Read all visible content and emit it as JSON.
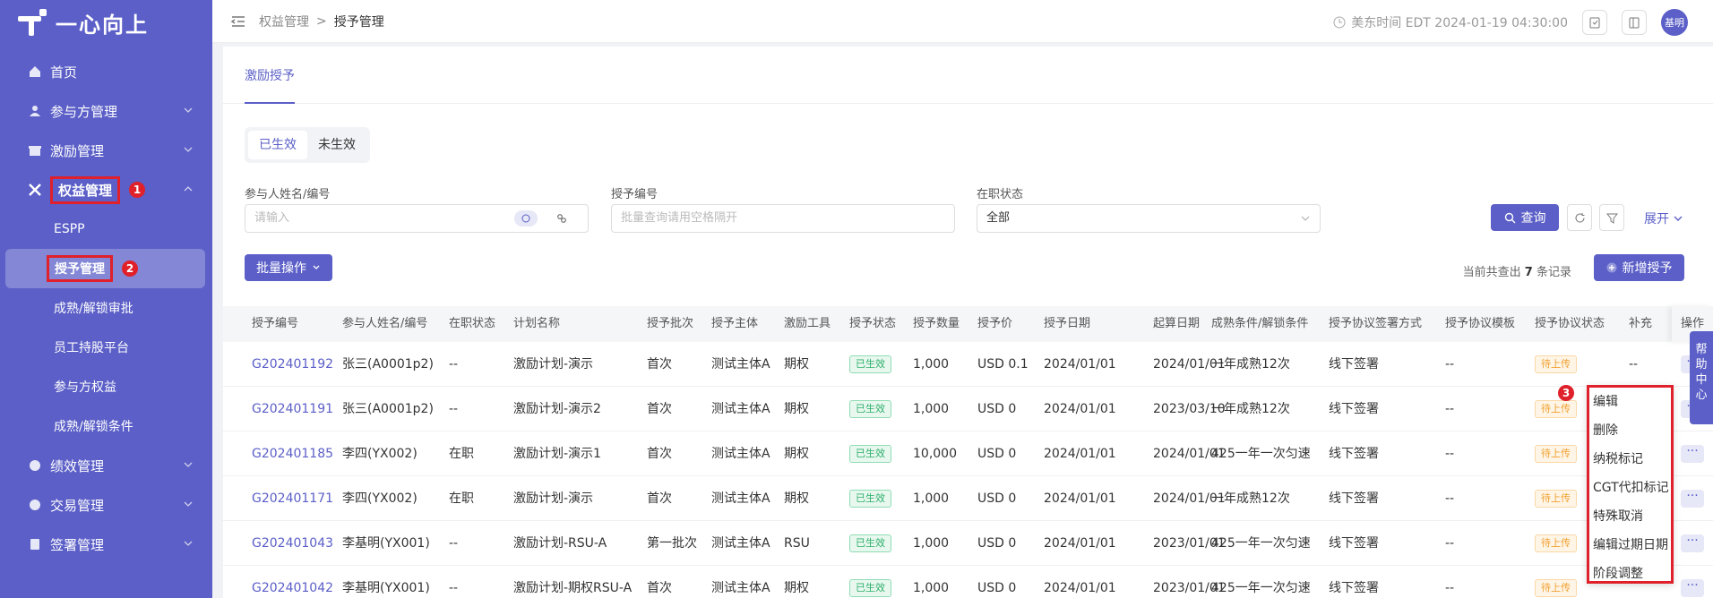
{
  "sidebar": {
    "logo_text": "一心向上",
    "items": [
      {
        "label": "首页",
        "icon": "home-icon"
      },
      {
        "label": "参与方管理",
        "icon": "users-icon"
      },
      {
        "label": "激励管理",
        "icon": "gift-icon"
      },
      {
        "label": "权益管理",
        "icon": "equity-icon"
      }
    ],
    "sub_items": [
      "ESPP",
      "授予管理",
      "成熟/解锁审批",
      "员工持股平台",
      "参与方权益",
      "成熟/解锁条件"
    ],
    "bottom_items": [
      {
        "label": "绩效管理",
        "icon": "performance-icon"
      },
      {
        "label": "交易管理",
        "icon": "trade-icon"
      },
      {
        "label": "签署管理",
        "icon": "sign-icon"
      }
    ],
    "badges": {
      "b1": "1",
      "b2": "2"
    }
  },
  "topbar": {
    "breadcrumb_parent": "权益管理",
    "breadcrumb_sep": ">",
    "breadcrumb_current": "授予管理",
    "time": "美东时间 EDT 2024-01-19 04:30:00",
    "avatar_text": "基明"
  },
  "main": {
    "tab": "激励授予",
    "segments": [
      "已生效",
      "未生效"
    ],
    "filters": {
      "participant_label": "参与人姓名/编号",
      "participant_placeholder": "请输入",
      "grant_no_label": "授予编号",
      "grant_no_placeholder": "批量查询请用空格隔开",
      "status_label": "在职状态",
      "status_value": "全部"
    },
    "query_button": "查询",
    "expand_label": "展开",
    "batch_button": "批量操作",
    "count_prefix": "当前共查出",
    "count_value": "7",
    "count_suffix": "条记录",
    "add_button": "新增授予"
  },
  "table": {
    "headers": [
      "授予编号",
      "参与人姓名/编号",
      "在职状态",
      "计划名称",
      "授予批次",
      "授予主体",
      "激励工具",
      "授予状态",
      "授予数量",
      "授予价",
      "授予日期",
      "起算日期",
      "成熟条件/解锁条件",
      "授予协议签署方式",
      "授予协议模板",
      "授予协议状态",
      "补充",
      "操作"
    ],
    "rows": [
      [
        "G202401192",
        "张三(A0001p2)",
        "--",
        "激励计划-演示",
        "首次",
        "测试主体A",
        "期权",
        "已生效",
        "1,000",
        "USD  0.1",
        "2024/01/01",
        "2024/01/01",
        "一年成熟12次",
        "线下签署",
        "--",
        "待上传",
        "--"
      ],
      [
        "G202401191",
        "张三(A0001p2)",
        "--",
        "激励计划-演示2",
        "首次",
        "测试主体A",
        "期权",
        "已生效",
        "1,000",
        "USD  0",
        "2024/01/01",
        "2023/03/10",
        "一年成熟12次",
        "线下签署",
        "--",
        "待上传",
        ""
      ],
      [
        "G202401185",
        "李四(YX002)",
        "在职",
        "激励计划-演示1",
        "首次",
        "测试主体A",
        "期权",
        "已生效",
        "10,000",
        "USD  0",
        "2024/01/01",
        "2024/01/01",
        "425一年一次匀速",
        "线下签署",
        "--",
        "待上传",
        ""
      ],
      [
        "G202401171",
        "李四(YX002)",
        "在职",
        "激励计划-演示",
        "首次",
        "测试主体A",
        "期权",
        "已生效",
        "1,000",
        "USD  0",
        "2024/01/01",
        "2024/01/01",
        "一年成熟12次",
        "线下签署",
        "--",
        "待上传",
        ""
      ],
      [
        "G202401043",
        "李基明(YX001)",
        "--",
        "激励计划-RSU-A",
        "第一批次",
        "测试主体A",
        "RSU",
        "已生效",
        "1,000",
        "USD  0",
        "2024/01/01",
        "2023/01/01",
        "425一年一次匀速",
        "线下签署",
        "--",
        "待上传",
        ""
      ],
      [
        "G202401042",
        "李基明(YX001)",
        "--",
        "激励计划-期权RSU-A",
        "首次",
        "测试主体A",
        "期权",
        "已生效",
        "1,000",
        "USD  0",
        "2024/01/01",
        "2023/01/01",
        "425一年一次匀速",
        "线下签署",
        "--",
        "待上传",
        ""
      ]
    ],
    "more_label": "···"
  },
  "dropdown": {
    "badge": "3",
    "items": [
      "编辑",
      "删除",
      "纳税标记",
      "CGT代扣标记",
      "特殊取消",
      "编辑过期日期",
      "阶段调整"
    ]
  },
  "help": "帮助中心",
  "colors": {
    "primary": "#5b5fc7",
    "highlight": "#e0202a",
    "success": "#2dae6a",
    "warning": "#f0a030"
  }
}
